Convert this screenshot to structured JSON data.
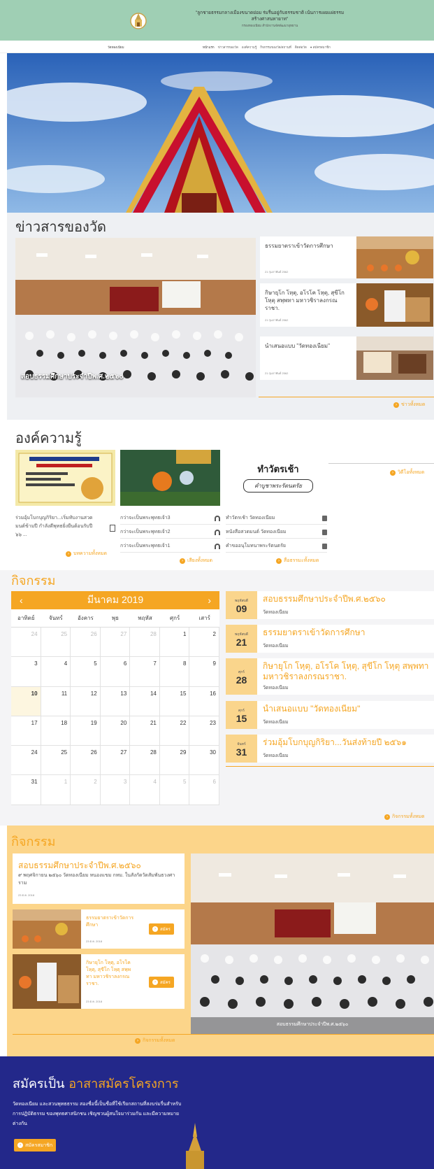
{
  "header": {
    "title_line1": "\"ลูกชายธรรมกลางเมืองขนาดย่อม ร่มรื่นอยู่กับธรรมชาติ เน้นการเผยแผ่ธรรม",
    "title_line2": "สร้างศาสนทายาท\"",
    "subtitle": "กรองทองเนียม สำนักงานจัดพัฒนาอุทยาน"
  },
  "nav": {
    "brand": "วัดทองเนียม",
    "items": [
      "หน้าแรก",
      "ข่าวสารของวัด",
      "องค์ความรู้",
      "กิจกรรมของวัด/สถานที่",
      "ติดต่อวัด",
      "สมัครสมาชิก"
    ]
  },
  "news": {
    "section_title": "ข่าวสารของวัด",
    "main_caption": "สอบธรรมศึกษาประจำปีพ.ศ.๒๕๖๐",
    "items": [
      {
        "title": "ธรรมยาตราเข้าวัดการศึกษา",
        "date": "21 กุมภาพันธ์ 2562"
      },
      {
        "title": "กิษายุโก โหฺตุ, อโรโค โหฺตุ, สุขีโก โหฺตุ สพฺพทา มหาวชิราลงกรณ ราชา.",
        "date": "21 กุมภาพันธ์ 2562"
      },
      {
        "title": "นำเสนอแบบ \"วัดทองเนียม\"",
        "date": "21 กุมภาพันธ์ 2562"
      }
    ],
    "more": "ข่าวทั้งหมด"
  },
  "knowledge": {
    "section_title": "องค์ความรู้",
    "articles": "ร่วมอุ้มโบกบุญกิริยา...เริ่มทับงานสวดมนต์ข้ามปี กำลังดีพุทธยิ่งยืนต้อนรับปี ๖๖ ...",
    "articles_more": "บทความทั้งหมด",
    "audio": [
      "กว่าจะเป็นพระพุทธเจ้า3",
      "กว่าจะเป็นพระพุทธเจ้า2",
      "กว่าจะเป็นพระพุทธเจ้า1"
    ],
    "audio_more": "เสียงทั้งหมด",
    "docs": [
      "ทำวัตรเช้า วัดทองเนียม",
      "หนังสือสวดมนต์ วัดทองเนียม",
      "คำขออนุโมทนาพระรัตนตรัย"
    ],
    "docs_more": "สื่อธรรมะทั้งหมด",
    "video_more": "วิดีโอทั้งหมด",
    "card_title": "ทำวัตรเช้า",
    "card_sub": "คำบูชาพระรัตนตรัย"
  },
  "calendar": {
    "section_title": "กิจกรรม",
    "month": "มีนาคม 2019",
    "prev": "‹",
    "next": "›",
    "dow": [
      "อาทิตย์",
      "จันทร์",
      "อังคาร",
      "พุธ",
      "พฤหัส",
      "ศุกร์",
      "เสาร์"
    ],
    "days": [
      "24",
      "25",
      "26",
      "27",
      "28",
      "1",
      "2",
      "3",
      "4",
      "5",
      "6",
      "7",
      "8",
      "9",
      "10",
      "11",
      "12",
      "13",
      "14",
      "15",
      "16",
      "17",
      "18",
      "19",
      "20",
      "21",
      "22",
      "23",
      "24",
      "25",
      "26",
      "27",
      "28",
      "29",
      "30",
      "31",
      "1",
      "2",
      "3",
      "4",
      "5",
      "6"
    ],
    "events": [
      {
        "dow": "พฤหัสบดี",
        "day": "09",
        "title": "สอบธรรมศึกษาประจำปีพ.ศ.๒๕๖๐",
        "place": "วัดทองเนียม"
      },
      {
        "dow": "พฤหัสบดี",
        "day": "21",
        "title": "ธรรมยาตราเข้าวัดการศึกษา",
        "place": "วัดทองเนียม"
      },
      {
        "dow": "ศุกร์",
        "day": "28",
        "title": "กิษายุโก โหฺตุ, อโรโค โหฺตุ, สุขีโก โหฺตุ สพฺพทา มหาวชิราลงกรณราชา.",
        "place": "วัดทองเนียม"
      },
      {
        "dow": "ศุกร์",
        "day": "15",
        "title": "นำเสนอแบบ \"วัดทองเนียม\"",
        "place": "วัดทองเนียม"
      },
      {
        "dow": "จันทร์",
        "day": "31",
        "title": "ร่วมอุ้มโบกบุญกิริยา...วันส่งท้ายปี ๒๕๖๑",
        "place": "วัดทองเนียม"
      }
    ],
    "more": "กิจกรรมทั้งหมด"
  },
  "activities": {
    "section_title": "กิจกรรม",
    "featured_title": "สอบธรรมศึกษาประจำปีพ.ศ.๒๕๖๐",
    "featured_desc": "๙ พฤศจิกายน ๒๕๖๐ วัดทองเนียม หนองแขม กทม. ในสังกัดวัดสัมพันธวงศาราม",
    "featured_date": "23 ต.ค. 2018",
    "items": [
      {
        "title": "ธรรมยาตราเข้าวัดการศึกษา",
        "date": "23 ต.ค. 2018",
        "button": "สมัคร"
      },
      {
        "title": "กิษายุโก โหฺตุ, อโรโค โหฺตุ, สุขีโก โหฺตุ สพฺพทา มหาวชิราลงกรณราชา.",
        "date": "23 ต.ค. 2018",
        "button": "สมัคร"
      }
    ],
    "image_caption": "สอบธรรมศึกษาประจำปีพ.ศ.๒๕๖๐",
    "more": "กิจกรรมทั้งหมด"
  },
  "volunteer": {
    "title_plain": "สมัครเป็น",
    "title_accent": "อาสาสมัครโครงการ",
    "desc": "วัดทองเนียม และสวนพุทธธรรม สองชื่อนี้เป็นชื่อที่ใช้เรียกสถานที่สงบร่มรื่นสำหรับการปฏิบัติธรรม ของพุทธศาสนิกชน เชิญชวนผู้สนใจมาร่วมกัน และมีความหมายต่างกัน",
    "button": "สมัครสมาชิก"
  },
  "colors": {
    "accent": "#f5a623",
    "header_green": "#9fcfb4",
    "volunteer_blue": "#23288a"
  }
}
